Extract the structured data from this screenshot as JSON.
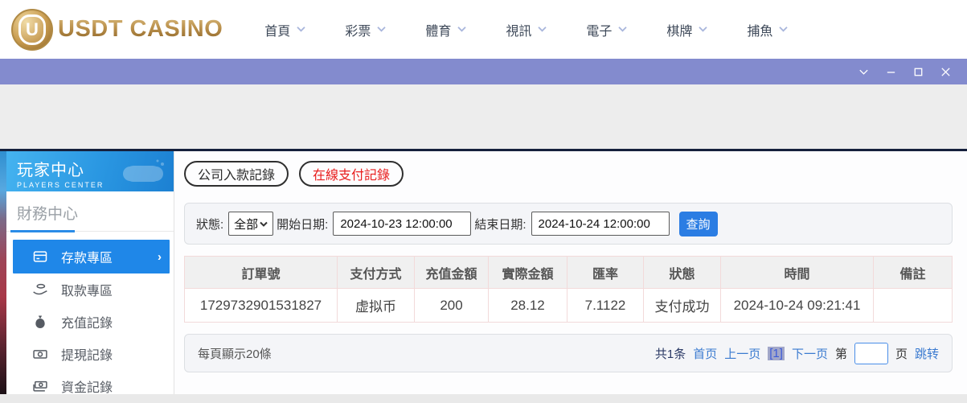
{
  "header": {
    "logo_text": "USDT CASINO",
    "logo_symbol": "U",
    "nav_items": [
      {
        "label": "首頁"
      },
      {
        "label": "彩票"
      },
      {
        "label": "體育"
      },
      {
        "label": "視訊"
      },
      {
        "label": "電子"
      },
      {
        "label": "棋牌"
      },
      {
        "label": "捕魚"
      }
    ]
  },
  "titlebar": {
    "controls": [
      "chevron-down",
      "minimize",
      "maximize",
      "close"
    ]
  },
  "sidebar": {
    "title": "玩家中心",
    "subtitle": "PLAYERS CENTER",
    "section_title": "財務中心",
    "items": [
      {
        "label": "存款專區",
        "icon": "deposit-card-icon",
        "active": true
      },
      {
        "label": "取款專區",
        "icon": "withdraw-hand-icon",
        "active": false
      },
      {
        "label": "充值記錄",
        "icon": "money-bag-icon",
        "active": false
      },
      {
        "label": "提現記錄",
        "icon": "banknote-icon",
        "active": false
      },
      {
        "label": "資金記錄",
        "icon": "banknote-stack-icon",
        "active": false
      }
    ]
  },
  "main": {
    "tabs": [
      {
        "label": "公司入款記錄",
        "active": false
      },
      {
        "label": "在線支付記錄",
        "active": true
      }
    ],
    "filters": {
      "status_label": "狀態:",
      "status_value": "全部",
      "start_label": "開始日期:",
      "start_value": "2024-10-23 12:00:00",
      "end_label": "結束日期:",
      "end_value": "2024-10-24 12:00:00",
      "search_label": "查詢"
    },
    "table": {
      "headers": [
        "訂單號",
        "支付方式",
        "充值金額",
        "實際金額",
        "匯率",
        "狀態",
        "時間",
        "備註"
      ],
      "rows": [
        [
          "1729732901531827",
          "虚拟币",
          "200",
          "28.12",
          "7.1122",
          "支付成功",
          "2024-10-24 09:21:41",
          ""
        ]
      ]
    },
    "pagination": {
      "page_size_text": "每頁顯示20條",
      "total_text": "共1条",
      "first_label": "首页",
      "prev_label": "上一页",
      "current_page": "[1]",
      "next_label": "下一页",
      "jump_prefix": "第",
      "jump_suffix": "页",
      "jump_label": "跳转"
    }
  },
  "colors": {
    "titlebar": "#838bce",
    "accent_blue": "#1f87e8",
    "button_blue": "#2b7de3",
    "link_blue": "#3a7ad0",
    "active_tab_red": "#e81c1c",
    "logo_gold": "#b98f4a",
    "table_border_pink": "#f2dada",
    "sidebar_gradient": [
      "#45b3f0",
      "#1c80d2"
    ]
  },
  "icons": {
    "nav_chevron": "chevron-down",
    "window": [
      "chevron-down",
      "minus",
      "square",
      "x"
    ],
    "sidebar_header": "gamepad",
    "active_item_arrow": "chevron-right"
  }
}
